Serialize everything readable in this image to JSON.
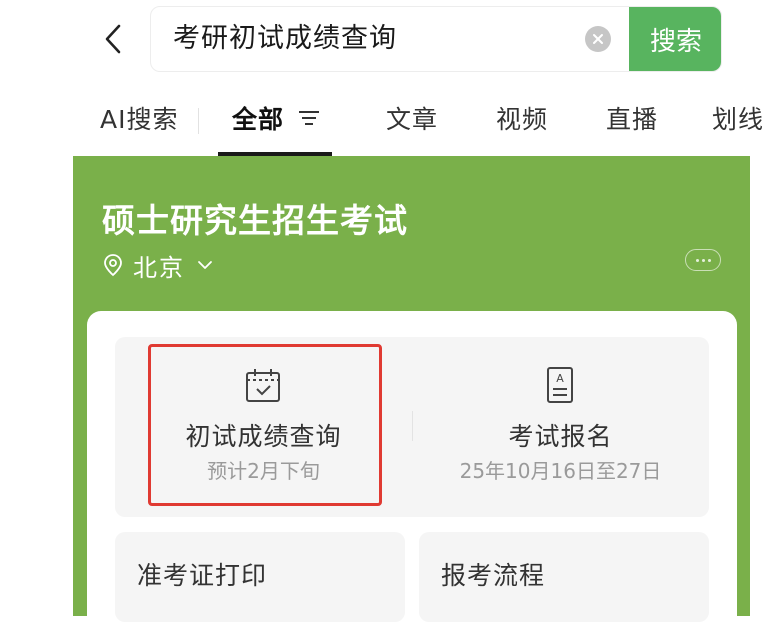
{
  "search": {
    "query": "考研初试成绩查询",
    "button_label": "搜索"
  },
  "tabs": [
    {
      "label": "AI搜索"
    },
    {
      "label": "全部",
      "active": true
    },
    {
      "label": "文章"
    },
    {
      "label": "视频"
    },
    {
      "label": "直播"
    },
    {
      "label": "划线"
    }
  ],
  "card": {
    "title": "硕士研究生招生考试",
    "location": "北京",
    "services": [
      {
        "icon": "calendar-check-icon",
        "title": "初试成绩查询",
        "subtitle": "预计2月下旬"
      },
      {
        "icon": "document-icon",
        "title": "考试报名",
        "subtitle": "25年10月16日至27日"
      }
    ],
    "links": [
      {
        "label": "准考证打印"
      },
      {
        "label": "报考流程"
      }
    ]
  },
  "colors": {
    "brand_green": "#58b45f",
    "card_green": "#7ab04a",
    "highlight_red": "#e03a32"
  }
}
